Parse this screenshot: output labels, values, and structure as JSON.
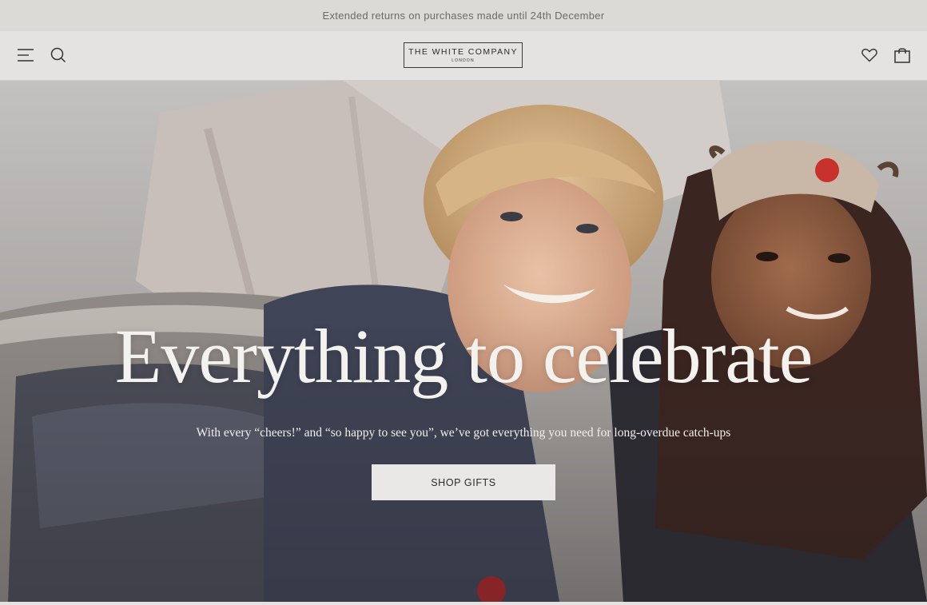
{
  "promo": {
    "text": "Extended returns on purchases made until 24th December"
  },
  "header": {
    "menu_icon": "hamburger-menu-icon",
    "search_icon": "search-icon",
    "wishlist_icon": "heart-icon",
    "bag_icon": "shopping-bag-icon",
    "logo_main": "THE WHITE COMPANY",
    "logo_sub": "LONDON"
  },
  "hero": {
    "title": "Everything to celebrate",
    "subtitle": "With every “cheers!” and “so happy to see you”, we’ve got everything you need for long-overdue catch-ups",
    "cta_label": "SHOP GIFTS"
  },
  "colors": {
    "promo_bg": "#dcdad6",
    "header_bg": "#e4e3e1",
    "cta_bg": "#e9e8e6",
    "title_text": "#f4f2ef"
  }
}
